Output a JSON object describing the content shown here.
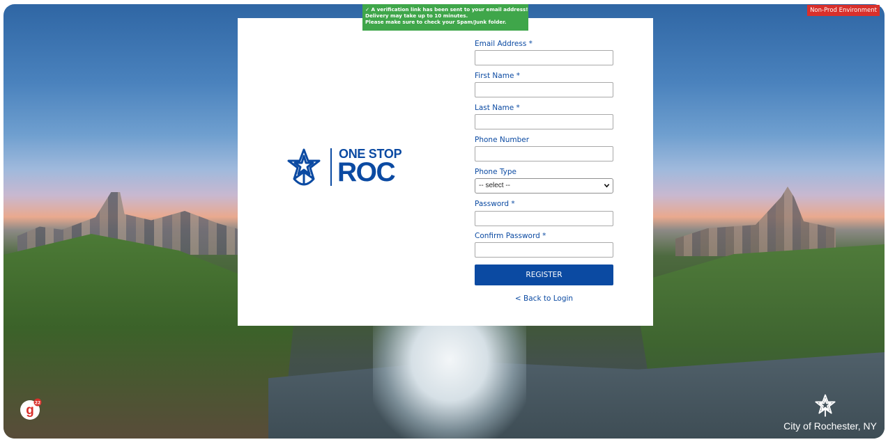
{
  "environment_tag": "Non-Prod Environment",
  "notification": {
    "line1": "✓ A verification link has been sent to your email address!",
    "line2": "Delivery may take up to 10 minutes.",
    "line3": "Please make sure to check your Spam/Junk folder."
  },
  "brand": {
    "line1": "ONE STOP",
    "line2": "ROC"
  },
  "form": {
    "email_label": "Email Address *",
    "first_name_label": "First Name *",
    "last_name_label": "Last Name *",
    "phone_number_label": "Phone Number",
    "phone_type_label": "Phone Type",
    "phone_type_selected": "-- select --",
    "password_label": "Password *",
    "confirm_password_label": "Confirm Password *",
    "register_label": "REGISTER",
    "back_to_login": "< Back to Login"
  },
  "footer": {
    "city_label": "City of Rochester, NY"
  },
  "colors": {
    "brand_blue": "#0b4aa2",
    "success_green": "#3fa64a",
    "env_red": "#d9302b"
  },
  "icons": [
    "rochester-flower-icon",
    "chevron-down-icon",
    "g-app-icon"
  ]
}
